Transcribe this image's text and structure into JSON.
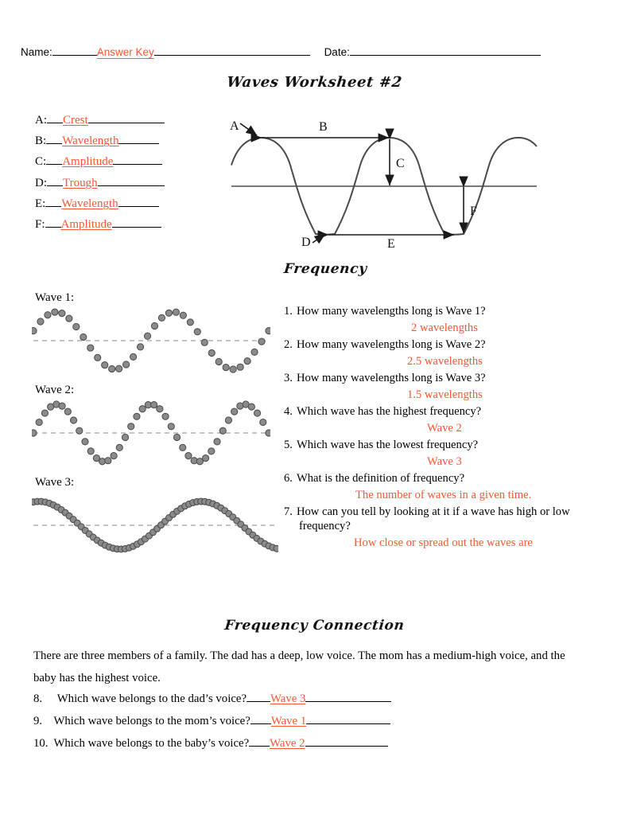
{
  "header": {
    "name_label": "Name:",
    "name_answer": "Answer Key",
    "date_label": "Date:"
  },
  "titles": {
    "main": "Waves Worksheet #2",
    "frequency": "Frequency",
    "frequency_connection": "Frequency Connection"
  },
  "labels_list": [
    {
      "letter": "A:",
      "answer": "Crest"
    },
    {
      "letter": "B:",
      "answer": "Wavelength"
    },
    {
      "letter": "C:",
      "answer": "Amplitude"
    },
    {
      "letter": "D:",
      "answer": "Trough"
    },
    {
      "letter": "E:",
      "answer": "Wavelength"
    },
    {
      "letter": "F:",
      "answer": "Amplitude"
    }
  ],
  "wave_diagram": {
    "marker_a": "A",
    "marker_b": "B",
    "marker_c": "C",
    "marker_d": "D",
    "marker_e": "E",
    "marker_f": "F"
  },
  "wave_panels": [
    {
      "label": "Wave 1:",
      "wavelengths": 2
    },
    {
      "label": "Wave 2:",
      "wavelengths": 2.5
    },
    {
      "label": "Wave 3:",
      "wavelengths": 1.5
    }
  ],
  "questions": [
    {
      "num": "1.",
      "text": "How many wavelengths long is Wave 1?",
      "answer": "2 wavelengths"
    },
    {
      "num": "2.",
      "text": "How many wavelengths long is Wave 2?",
      "answer": "2.5 wavelengths"
    },
    {
      "num": "3.",
      "text": "How many wavelengths long is Wave 3?",
      "answer": "1.5 wavelengths"
    },
    {
      "num": "4.",
      "text": "Which wave has the highest frequency?",
      "answer": "Wave 2"
    },
    {
      "num": "5.",
      "text": "Which wave has the lowest frequency?",
      "answer": "Wave 3"
    },
    {
      "num": "6.",
      "text": "What is the definition of frequency?",
      "answer": "The number of waves in a given time."
    },
    {
      "num": "7.",
      "text": "How can you tell by looking at it if a wave has high or low",
      "text_line2": "frequency?",
      "answer": "How close or spread out the waves are"
    }
  ],
  "connection": {
    "paragraph": "There are three members of a family.  The dad has a deep, low voice.  The mom has a medium-high voice, and the baby has the highest voice.",
    "items": [
      {
        "num": "8.",
        "text": "Which wave belongs to the dad’s voice?",
        "answer": "Wave 3"
      },
      {
        "num": "9.",
        "text": "Which wave belongs to the mom’s voice?",
        "answer": "Wave 1"
      },
      {
        "num": "10.",
        "text": "Which wave belongs to the baby’s voice?",
        "answer": "Wave 2"
      }
    ]
  },
  "colors": {
    "answer_red": "#FF5533",
    "ink": "#000000",
    "dot_fill": "#8a8a8a",
    "dot_stroke": "#4a4a4a",
    "dash_line": "#b0b0b0"
  }
}
